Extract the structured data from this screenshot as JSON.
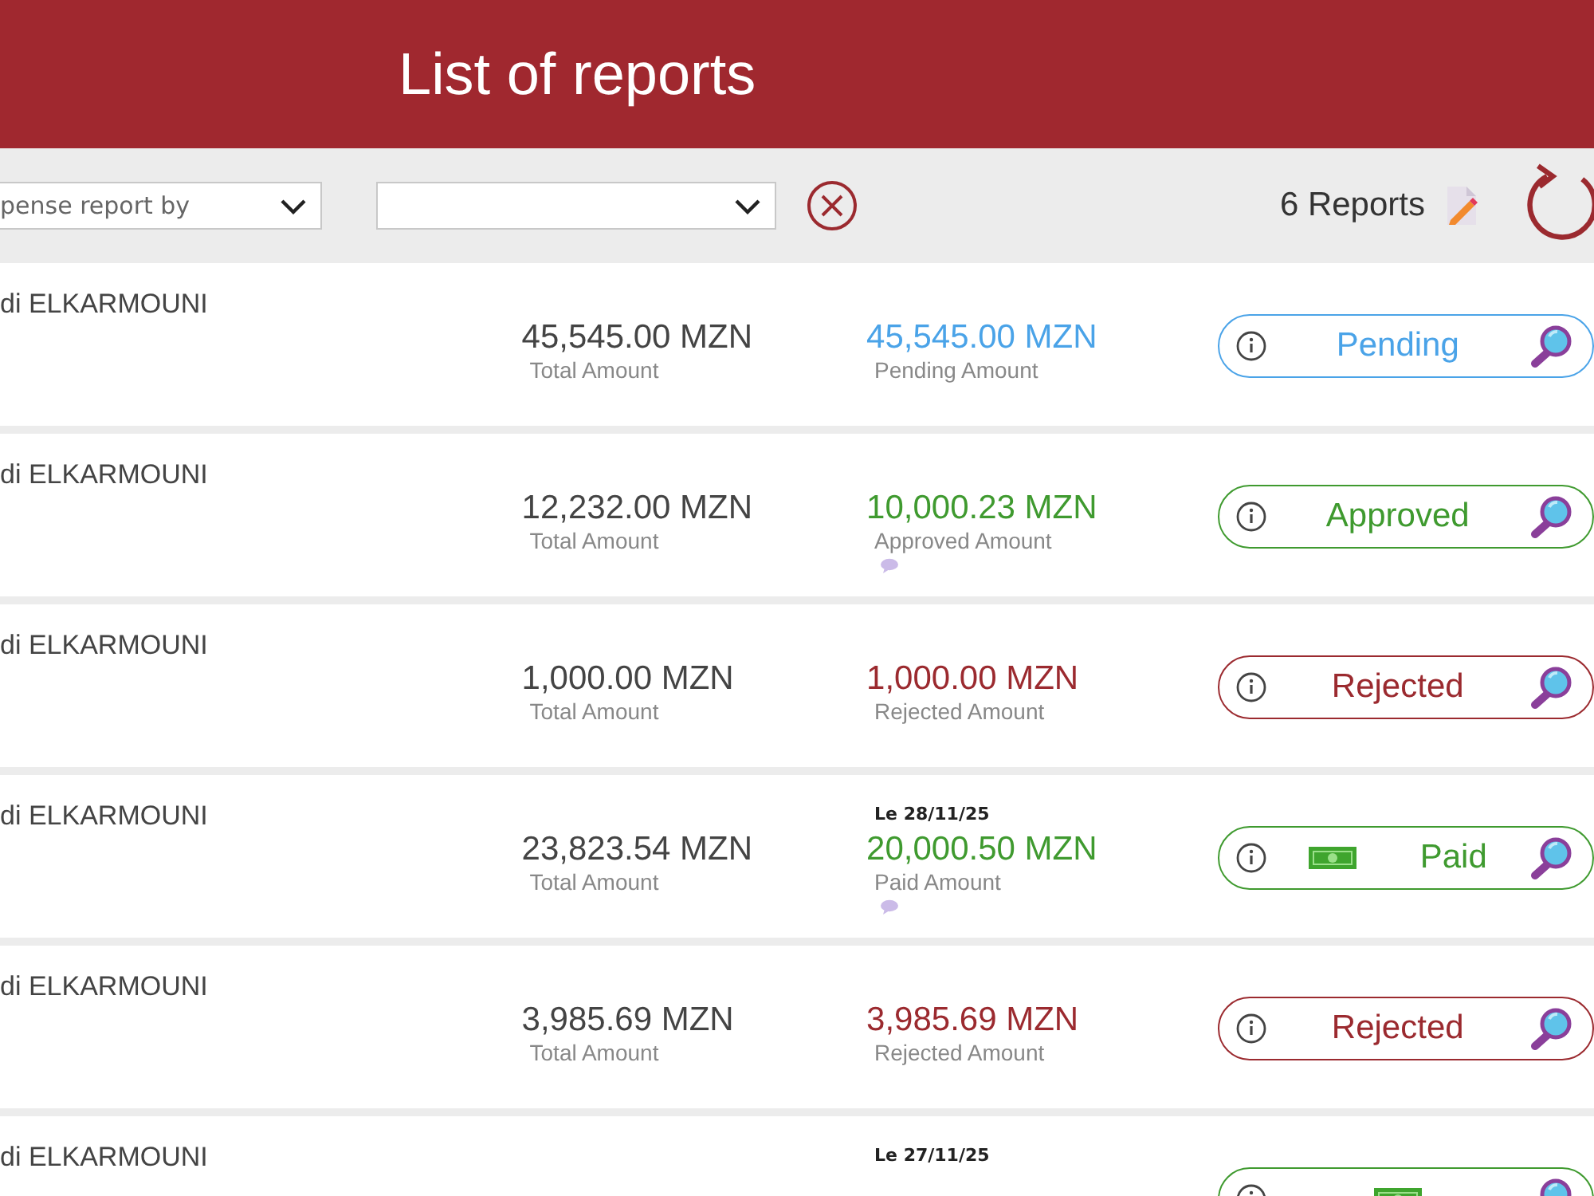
{
  "header": {
    "title": "List of reports"
  },
  "toolbar": {
    "filter_1": {
      "value": "pense report by"
    },
    "count": "6 Reports"
  },
  "reports": [
    {
      "name": "di ELKARMOUNI",
      "total": "45,545.00 MZN",
      "total_label": "Total Amount",
      "amount": "45,545.00 MZN",
      "amount_label": "Pending Amount",
      "comment": false,
      "status": {
        "kind": "pending",
        "label": "Pending"
      }
    },
    {
      "name": "di ELKARMOUNI",
      "total": "12,232.00 MZN",
      "total_label": "Total Amount",
      "amount": "10,000.23 MZN",
      "amount_label": "Approved Amount",
      "comment": true,
      "status": {
        "kind": "approved",
        "label": "Approved"
      }
    },
    {
      "name": "di ELKARMOUNI",
      "total": "1,000.00 MZN",
      "total_label": "Total Amount",
      "amount": "1,000.00 MZN",
      "amount_label": "Rejected Amount",
      "comment": false,
      "status": {
        "kind": "rejected",
        "label": "Rejected"
      }
    },
    {
      "name": "di ELKARMOUNI",
      "total": "23,823.54 MZN",
      "total_label": "Total Amount",
      "date": "Le 28/11/25",
      "amount": "20,000.50 MZN",
      "amount_label": "Paid Amount",
      "comment": true,
      "status": {
        "kind": "paid",
        "label": "Paid"
      }
    },
    {
      "name": "di ELKARMOUNI",
      "total": "3,985.69 MZN",
      "total_label": "Total Amount",
      "amount": "3,985.69 MZN",
      "amount_label": "Rejected Amount",
      "comment": false,
      "status": {
        "kind": "rejected",
        "label": "Rejected"
      }
    },
    {
      "name": "di ELKARMOUNI",
      "date": "Le 27/11/25",
      "status": {
        "kind": "paid"
      }
    }
  ]
}
